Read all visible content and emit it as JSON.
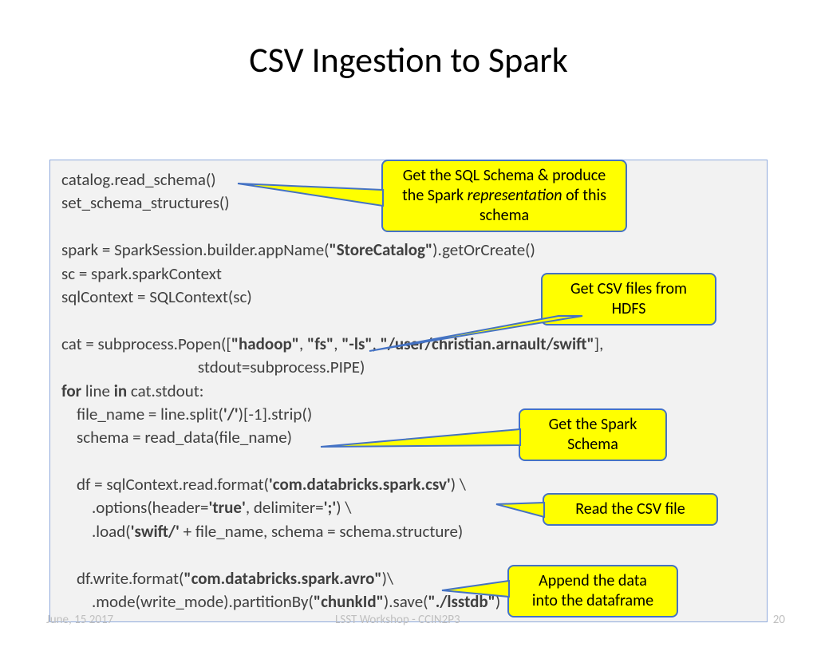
{
  "title": "CSV Ingestion to Spark",
  "code": {
    "l1": "catalog.read_schema()",
    "l2": "set_schema_structures()",
    "l4a": "spark = SparkSession.builder.appName(",
    "l4b": "\"StoreCatalog\"",
    "l4c": ").getOrCreate()",
    "l5": "sc = spark.sparkContext",
    "l6": "sqlContext = SQLContext(sc)",
    "l8a": "cat = subprocess.Popen([",
    "l8b": "\"hadoop\"",
    "l8c": ", ",
    "l8d": "\"fs\"",
    "l8e": ", ",
    "l8f": "\"-ls\"",
    "l8g": ", ",
    "l8h": "\"/user/christian.arnault/swift\"",
    "l8i": "],",
    "l9": "                                    stdout=subprocess.PIPE)",
    "l10a": "for",
    "l10b": " line ",
    "l10c": "in",
    "l10d": " cat.stdout:",
    "l11a": "    file_name = line.split(",
    "l11b": "'/'",
    "l11c": ")[-1].strip()",
    "l12": "    schema = read_data(file_name)",
    "l14a": "    df = sqlContext.read.format(",
    "l14b": "'com.databricks.spark.csv'",
    "l14c": ") \\",
    "l15a": "        .options(header=",
    "l15b": "'true'",
    "l15c": ", delimiter=",
    "l15d": "';'",
    "l15e": ") \\",
    "l16a": "        .load(",
    "l16b": "'swift/'",
    "l16c": " + file_name, schema = schema.structure)",
    "l18a": "    df.write.format(",
    "l18b": "\"com.databricks.spark.avro\"",
    "l18c": ")\\",
    "l19a": "        .mode(write_mode).partitionBy(",
    "l19b": "\"chunkId\"",
    "l19c": ").save(",
    "l19d": "\"./lsstdb\"",
    "l19e": ")"
  },
  "callouts": {
    "c1a": "Get the SQL Schema & produce",
    "c1b": "the Spark ",
    "c1c": "representation",
    "c1d": " of this",
    "c1e": "schema",
    "c2a": "Get CSV files from",
    "c2b": "HDFS",
    "c3a": "Get the Spark",
    "c3b": "Schema",
    "c4": "Read the CSV file",
    "c5a": "Append the data",
    "c5b": "into the dataframe"
  },
  "footer": {
    "left": "June, 15 2017",
    "center": "LSST Workshop - CCIN2P3",
    "right": "20"
  }
}
